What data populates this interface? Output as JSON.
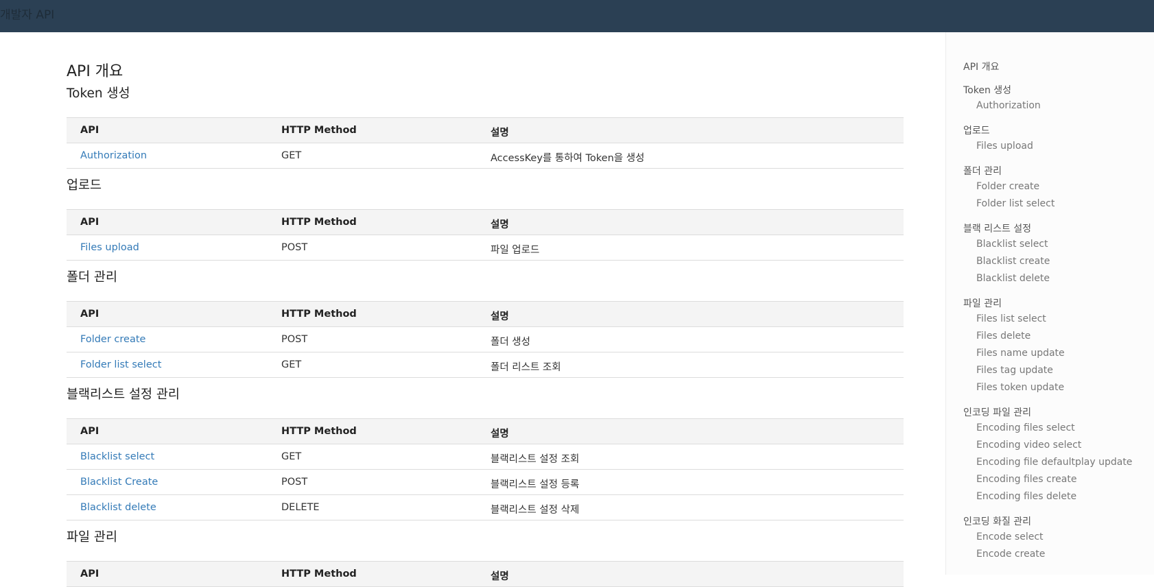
{
  "header": {
    "title": "개발자 API"
  },
  "main": {
    "page_title": "API 개요",
    "sections": [
      {
        "title": "Token 생성",
        "columns": [
          "API",
          "HTTP Method",
          "설명"
        ],
        "rows": [
          {
            "api": "Authorization",
            "method": "GET",
            "desc": "AccessKey를 통하여 Token을 생성"
          }
        ]
      },
      {
        "title": "업로드",
        "columns": [
          "API",
          "HTTP Method",
          "설명"
        ],
        "rows": [
          {
            "api": "Files upload",
            "method": "POST",
            "desc": "파일 업로드"
          }
        ]
      },
      {
        "title": "폴더 관리",
        "columns": [
          "API",
          "HTTP Method",
          "설명"
        ],
        "rows": [
          {
            "api": "Folder create",
            "method": "POST",
            "desc": "폴더 생성"
          },
          {
            "api": "Folder list select",
            "method": "GET",
            "desc": "폴더 리스트 조회"
          }
        ]
      },
      {
        "title": "블랙리스트 설정 관리",
        "columns": [
          "API",
          "HTTP Method",
          "설명"
        ],
        "rows": [
          {
            "api": "Blacklist select",
            "method": "GET",
            "desc": "블랙리스트 설정 조회"
          },
          {
            "api": "Blacklist Create",
            "method": "POST",
            "desc": "블랙리스트 설정 등록"
          },
          {
            "api": "Blacklist delete",
            "method": "DELETE",
            "desc": "블랙리스트 설정 삭제"
          }
        ]
      },
      {
        "title": "파일 관리",
        "columns": [
          "API",
          "HTTP Method",
          "설명"
        ],
        "rows": []
      }
    ]
  },
  "nav": {
    "groups": [
      {
        "label": "API 개요",
        "items": []
      },
      {
        "label": "Token 생성",
        "items": [
          "Authorization"
        ]
      },
      {
        "label": "업로드",
        "items": [
          "Files upload"
        ]
      },
      {
        "label": "폴더 관리",
        "items": [
          "Folder create",
          "Folder list select"
        ]
      },
      {
        "label": "블랙 리스트 설정",
        "items": [
          "Blacklist select",
          "Blacklist create",
          "Blacklist delete"
        ]
      },
      {
        "label": "파일 관리",
        "items": [
          "Files list select",
          "Files delete",
          "Files name update",
          "Files tag update",
          "Files token update"
        ]
      },
      {
        "label": "인코딩 파일 관리",
        "items": [
          "Encoding files select",
          "Encoding video select",
          "Encoding file defaultplay update",
          "Encoding files create",
          "Encoding files delete"
        ]
      },
      {
        "label": "인코딩 화질 관리",
        "items": [
          "Encode select",
          "Encode create"
        ]
      }
    ]
  },
  "colors": {
    "topbar": "#2b4054",
    "link": "#337ab7",
    "table_header_bg": "#f4f4f4"
  }
}
